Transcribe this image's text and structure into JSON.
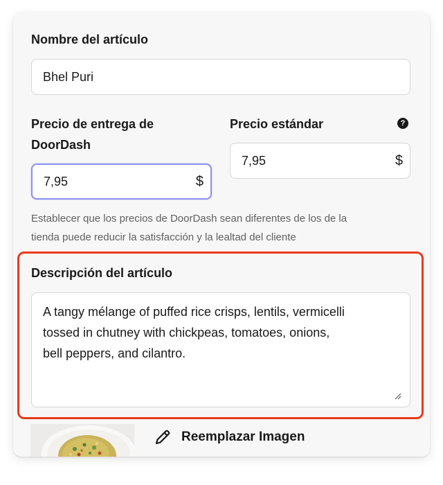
{
  "item_name": {
    "label": "Nombre del artículo",
    "value": "Bhel Puri"
  },
  "delivery_price": {
    "label_line1": "Precio de entrega de",
    "label_line2": "DoorDash",
    "value": "7,95",
    "currency": "$"
  },
  "standard_price": {
    "label": "Precio estándar",
    "value": "7,95",
    "currency": "$",
    "help_icon": "question-circle-icon"
  },
  "price_note": {
    "line1": "Establecer que los precios de DoorDash sean diferentes de los de la",
    "line2": "tienda puede reducir la satisfacción y la lealtad del cliente"
  },
  "description": {
    "label": "Descripción del artículo",
    "line1": "A tangy mélange of puffed rice crisps, lentils, vermicelli",
    "line2": "tossed in chutney with chickpeas, tomatoes, onions,",
    "line3": "bell peppers, and cilantro."
  },
  "image": {
    "replace_label": "Reemplazar Imagen",
    "edit_icon": "pencil-icon"
  },
  "colors": {
    "highlight": "#e8391f",
    "focus": "#8e94f2",
    "card_bg": "#f7f7f7"
  }
}
